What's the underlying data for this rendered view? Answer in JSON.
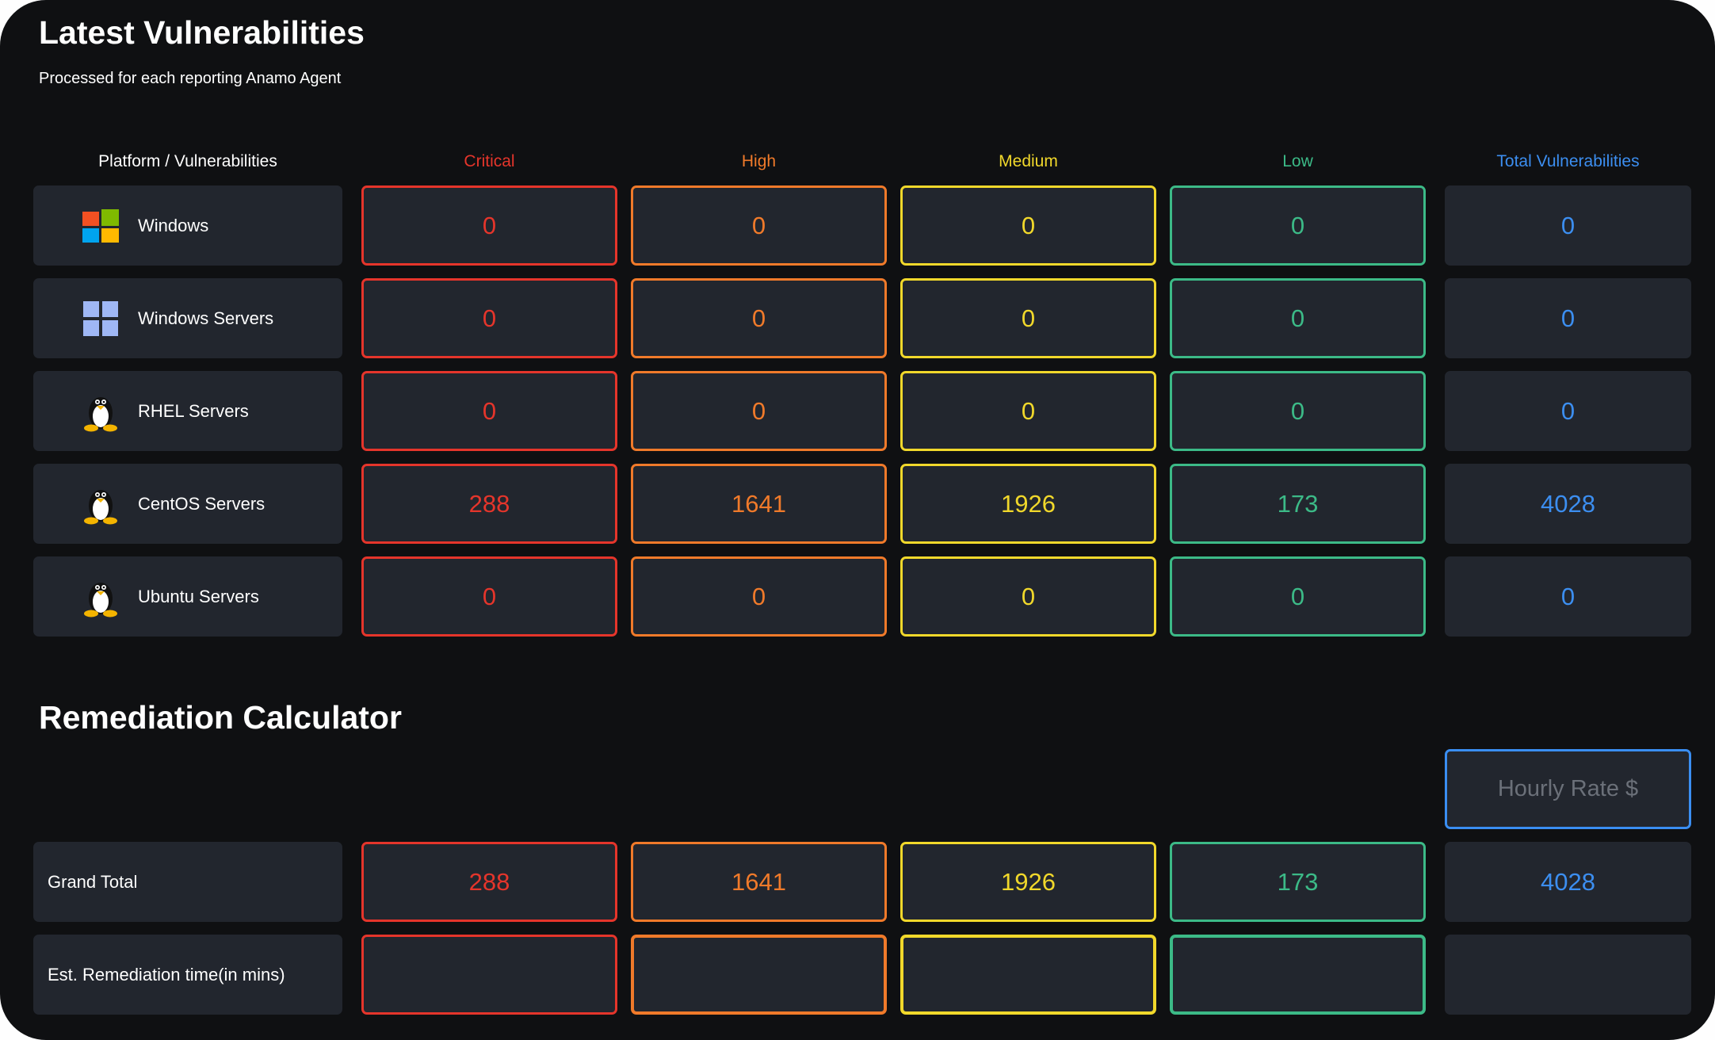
{
  "header": {
    "title": "Latest Vulnerabilities",
    "subtitle": "Processed for each reporting Anamo Agent"
  },
  "columns": {
    "platform": "Platform / Vulnerabilities",
    "critical": "Critical",
    "high": "High",
    "medium": "Medium",
    "low": "Low",
    "total": "Total Vulnerabilities"
  },
  "rows": [
    {
      "platform": "Windows",
      "icon": "windows-logo-icon",
      "critical": "0",
      "high": "0",
      "medium": "0",
      "low": "0",
      "total": "0"
    },
    {
      "platform": "Windows Servers",
      "icon": "windows-server-icon",
      "critical": "0",
      "high": "0",
      "medium": "0",
      "low": "0",
      "total": "0"
    },
    {
      "platform": "RHEL Servers",
      "icon": "linux-penguin-icon",
      "critical": "0",
      "high": "0",
      "medium": "0",
      "low": "0",
      "total": "0"
    },
    {
      "platform": "CentOS Servers",
      "icon": "linux-penguin-icon",
      "critical": "288",
      "high": "1641",
      "medium": "1926",
      "low": "173",
      "total": "4028"
    },
    {
      "platform": "Ubuntu Servers",
      "icon": "linux-penguin-icon",
      "critical": "0",
      "high": "0",
      "medium": "0",
      "low": "0",
      "total": "0"
    }
  ],
  "calculator": {
    "title": "Remediation Calculator",
    "hourly_rate_placeholder": "Hourly Rate $",
    "hourly_rate_value": "",
    "grand_total": {
      "label": "Grand Total",
      "critical": "288",
      "high": "1641",
      "medium": "1926",
      "low": "173",
      "total": "4028"
    },
    "remediation_time": {
      "label": "Est. Remediation time(in mins)",
      "critical": "",
      "high": "",
      "medium": "",
      "low": "",
      "total": ""
    }
  },
  "colors": {
    "background": "#0f1012",
    "cell": "#22262e",
    "critical": "#e5352b",
    "high": "#f07a2a",
    "medium": "#f1d82b",
    "low": "#3cba87",
    "total": "#3c8ef0"
  }
}
